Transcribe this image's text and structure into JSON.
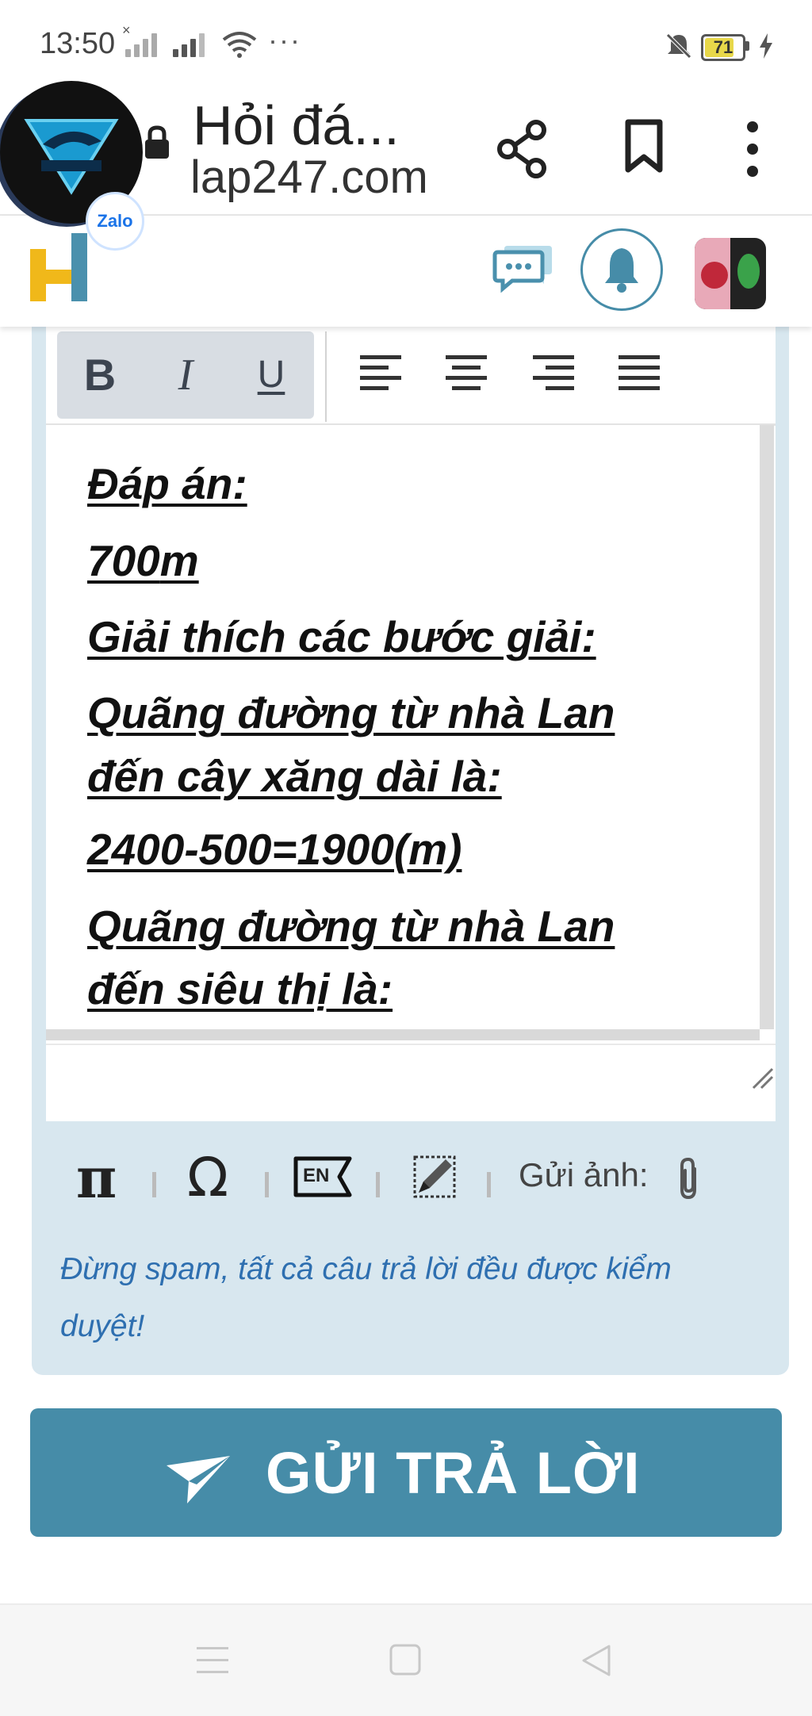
{
  "status_bar": {
    "time": "13:50",
    "more": "···",
    "battery": "71",
    "colors": {
      "battery_fill": "#e8d84a"
    },
    "icons": [
      "no-sim-signal-icon",
      "signal-icon",
      "wifi-icon",
      "mute-icon",
      "charging-icon"
    ]
  },
  "browser": {
    "title": "Hỏi đá...",
    "url": "lap247.com",
    "icons": [
      "lock-icon",
      "share-icon",
      "bookmark-icon",
      "more-vert-icon"
    ]
  },
  "overlay": {
    "zalo_label": "Zalo"
  },
  "site_header": {
    "logo_letter": "H",
    "colors": {
      "logo_yellow": "#f0b81a",
      "logo_blue": "#4a90ad",
      "accent": "#468ca8"
    },
    "icons": [
      "chat-icon",
      "bell-icon",
      "avatar"
    ]
  },
  "editor": {
    "toolbar": {
      "bold": "B",
      "italic": "I",
      "underline": "U",
      "icons": [
        "align-left-icon",
        "align-center-icon",
        "align-right-icon",
        "align-justify-icon"
      ]
    },
    "content": {
      "line1": "Đáp án:",
      "line2_value": " 700",
      "line2_unit": "m",
      "line3": "Giải thích các bước giải:",
      "line4": " Quãng đường từ nhà Lan",
      "line5": "đến cây xăng dài là:",
      "line6": "2400-500=1900(m)",
      "line7": "Quãng đường từ nhà Lan",
      "line8": "đến siêu thị là:"
    },
    "tools": {
      "pi": "π",
      "omega": "Ω",
      "en_label": "EN",
      "attach_label": "Gửi ảnh:",
      "icons": [
        "pi-icon",
        "omega-icon",
        "english-keyboard-icon",
        "draw-icon",
        "paperclip-icon"
      ]
    },
    "notice": "Đừng spam, tất cả câu trả lời đều được kiểm duyệt!"
  },
  "submit": {
    "label": "GỬI TRẢ LỜI",
    "color": "#468ca8"
  },
  "nav": {
    "icons": [
      "menu-icon",
      "home-icon",
      "back-icon"
    ]
  }
}
